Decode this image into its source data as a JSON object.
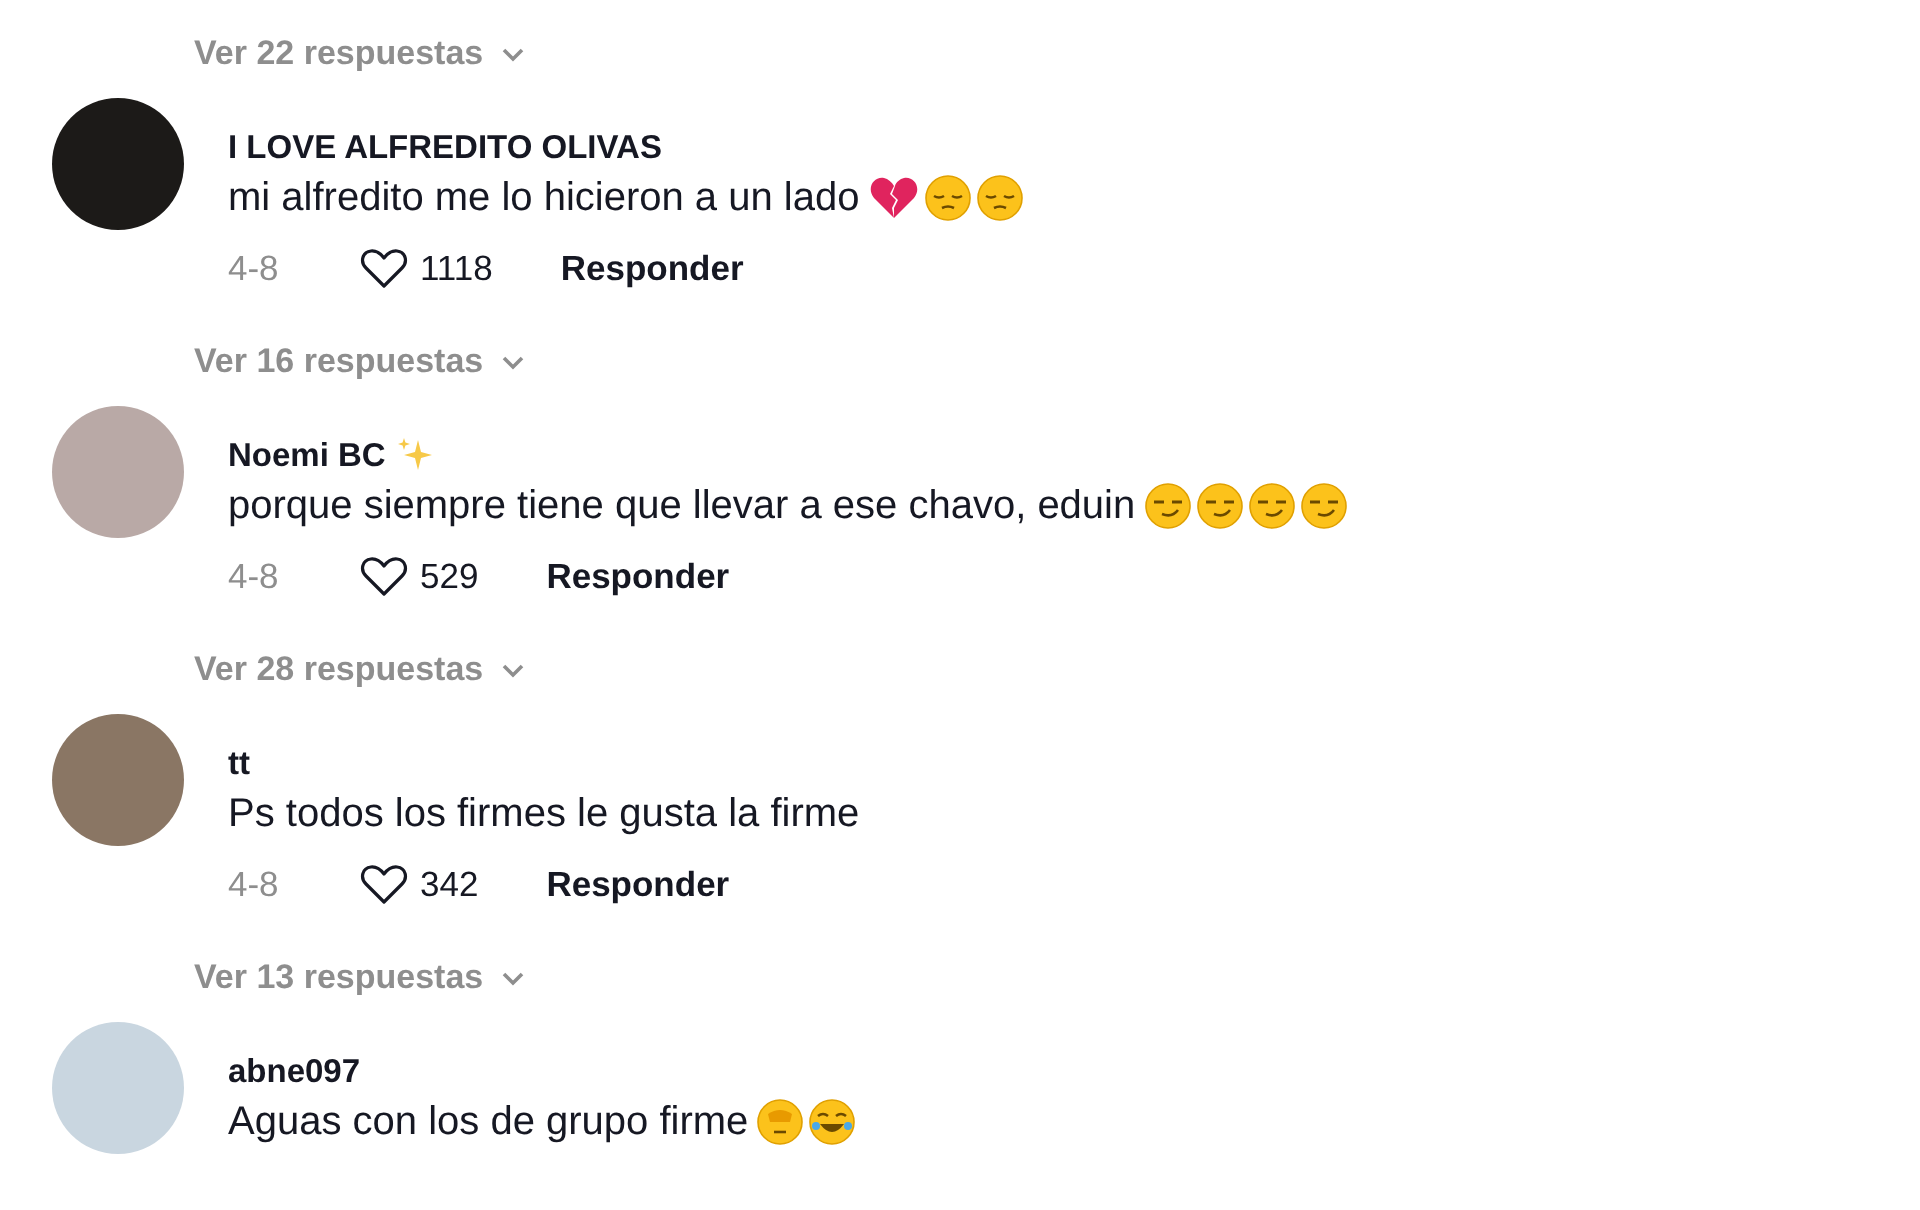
{
  "threads": [
    {
      "replies_link": "Ver 22 respuestas",
      "comment": {
        "author": "I LOVE ALFREDITO OLIVAS",
        "text": "mi alfredito me lo hicieron a un lado",
        "emoji": [
          {
            "kind": "broken-heart"
          },
          {
            "kind": "pensive"
          },
          {
            "kind": "pensive"
          }
        ],
        "date": "4-8",
        "likes": "1118",
        "reply": "Responder"
      }
    },
    {
      "replies_link": "Ver 16 respuestas",
      "comment": {
        "author": "Noemi BC",
        "author_emoji": [
          {
            "kind": "sparkles"
          }
        ],
        "text": "porque siempre tiene que llevar a ese chavo, eduin",
        "emoji": [
          {
            "kind": "smirk"
          },
          {
            "kind": "smirk"
          },
          {
            "kind": "smirk"
          },
          {
            "kind": "smirk"
          }
        ],
        "date": "4-8",
        "likes": "529",
        "reply": "Responder"
      }
    },
    {
      "replies_link": "Ver 28 respuestas",
      "comment": {
        "author": "tt",
        "text": "Ps todos los firmes le gusta la firme",
        "date": "4-8",
        "likes": "342",
        "reply": "Responder"
      }
    },
    {
      "replies_link": "Ver 13 respuestas",
      "comment": {
        "author": "abne097",
        "text": "Aguas con los de grupo firme",
        "emoji": [
          {
            "kind": "face"
          },
          {
            "kind": "laughing"
          }
        ]
      }
    }
  ]
}
